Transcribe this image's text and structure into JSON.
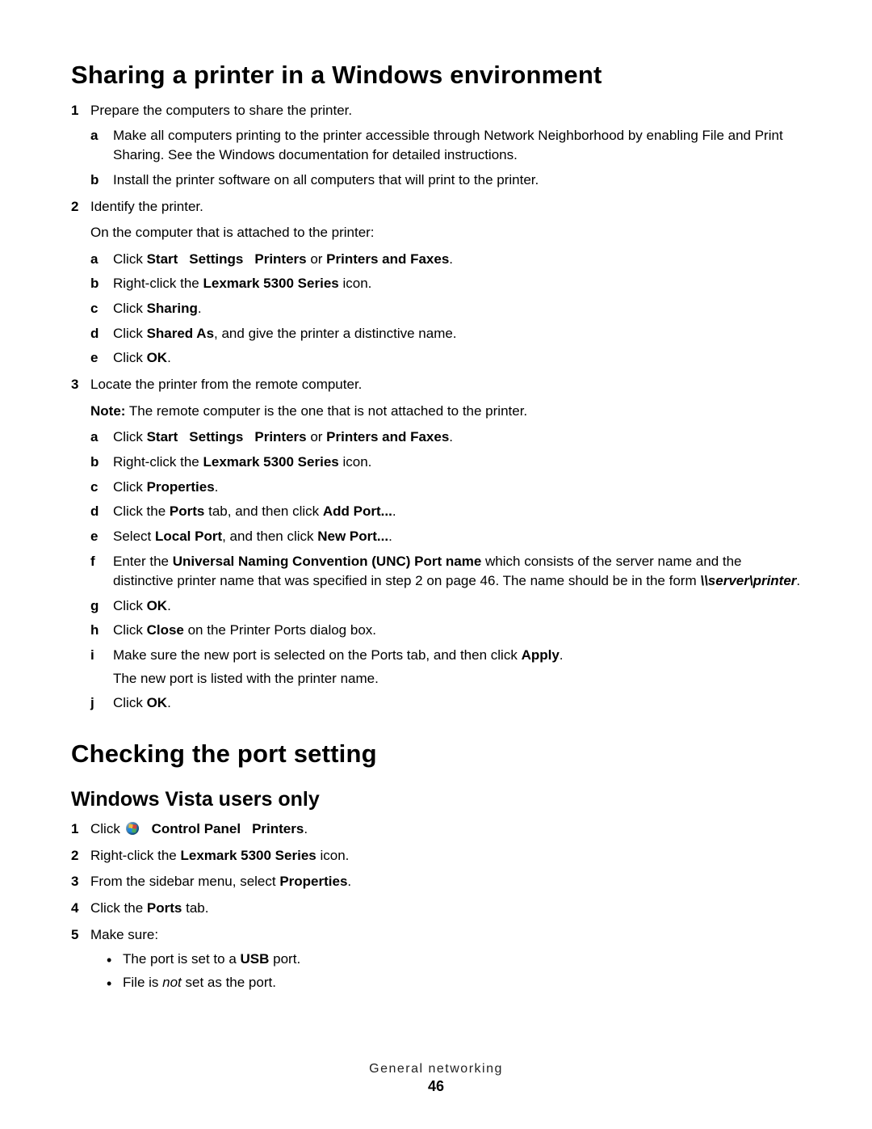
{
  "title1": "Sharing a printer in a Windows environment",
  "s1": {
    "n1": "Prepare the computers to share the printer.",
    "n1a": "Make all computers printing to the printer accessible through Network Neighborhood by enabling File and Print Sharing. See the Windows documentation for detailed instructions.",
    "n1b": "Install the printer software on all computers that will print to the printer.",
    "n2": "Identify the printer.",
    "n2p": "On the computer that is attached to the printer:",
    "n2a_pre": "Click ",
    "n2a_b1": "Start",
    "n2a_b2": "Settings",
    "n2a_b3": "Printers",
    "n2a_mid": " or ",
    "n2a_b4": "Printers and Faxes",
    "n2a_suf": ".",
    "n2b_pre": "Right-click the ",
    "n2b_b": "Lexmark 5300 Series",
    "n2b_suf": " icon.",
    "n2c_pre": "Click ",
    "n2c_b": "Sharing",
    "n2c_suf": ".",
    "n2d_pre": "Click ",
    "n2d_b": "Shared As",
    "n2d_suf": ", and give the printer a distinctive name.",
    "n2e_pre": "Click ",
    "n2e_b": "OK",
    "n2e_suf": ".",
    "n3": "Locate the printer from the remote computer.",
    "n3note_b": "Note:",
    "n3note": " The remote computer is the one that is not attached to the printer.",
    "n3a_pre": "Click ",
    "n3a_b1": "Start",
    "n3a_b2": "Settings",
    "n3a_b3": "Printers",
    "n3a_mid": " or ",
    "n3a_b4": "Printers and Faxes",
    "n3a_suf": ".",
    "n3b_pre": "Right-click the ",
    "n3b_b": "Lexmark 5300 Series",
    "n3b_suf": " icon.",
    "n3c_pre": "Click ",
    "n3c_b": "Properties",
    "n3c_suf": ".",
    "n3d_pre": "Click the ",
    "n3d_b1": "Ports",
    "n3d_mid": " tab, and then click ",
    "n3d_b2": "Add Port...",
    "n3d_suf": ".",
    "n3e_pre": "Select ",
    "n3e_b1": "Local Port",
    "n3e_mid": ", and then click ",
    "n3e_b2": "New Port...",
    "n3e_suf": ".",
    "n3f_pre": "Enter the ",
    "n3f_b1": "Universal Naming Convention (UNC) Port name",
    "n3f_mid": " which consists of the server name and the distinctive printer name that was specified in step 2 on page 46. The name should be in the form ",
    "n3f_bi": "\\\\server\\printer",
    "n3f_suf": ".",
    "n3g_pre": "Click ",
    "n3g_b": "OK",
    "n3g_suf": ".",
    "n3h_pre": "Click ",
    "n3h_b": "Close",
    "n3h_suf": " on the Printer Ports dialog box.",
    "n3i_pre": "Make sure the new port is selected on the Ports tab, and then click ",
    "n3i_b": "Apply",
    "n3i_suf": ".",
    "n3i_p2": "The new port is listed with the printer name.",
    "n3j_pre": "Click ",
    "n3j_b": "OK",
    "n3j_suf": "."
  },
  "title2": "Checking the port setting",
  "subtitle2": "Windows Vista users only",
  "s2": {
    "n1_pre": "Click ",
    "n1_b1": "Control Panel",
    "n1_b2": "Printers",
    "n1_suf": ".",
    "n2_pre": "Right-click the ",
    "n2_b": "Lexmark 5300 Series",
    "n2_suf": " icon.",
    "n3_pre": "From the sidebar menu, select ",
    "n3_b": "Properties",
    "n3_suf": ".",
    "n4_pre": "Click the ",
    "n4_b": "Ports",
    "n4_suf": " tab.",
    "n5": "Make sure:",
    "n5a_pre": "The port is set to a ",
    "n5a_b": "USB",
    "n5a_suf": " port.",
    "n5b_pre": "File is ",
    "n5b_i": "not",
    "n5b_suf": " set as the port."
  },
  "footer": {
    "title": "General networking",
    "page": "46"
  }
}
